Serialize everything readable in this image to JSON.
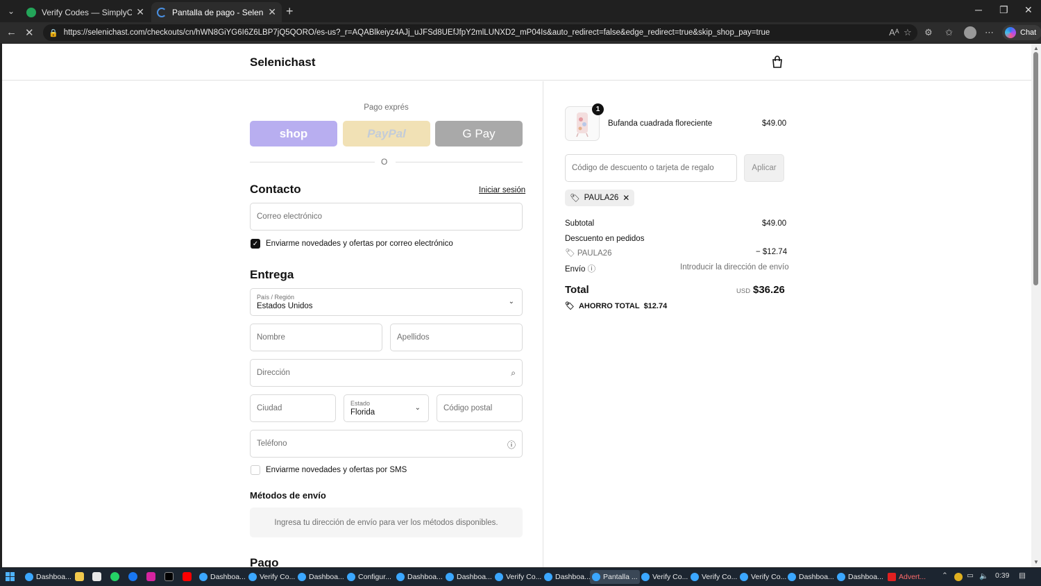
{
  "browser": {
    "tabs": [
      {
        "title": "Verify Codes — SimplyCodes",
        "favicon": "checkmark-icon",
        "color": "#23a559",
        "active": false
      },
      {
        "title": "Pantalla de pago - Selenichast",
        "favicon": "loading-icon",
        "color": "#4a90e2",
        "active": true
      }
    ],
    "url": "https://selenichast.com/checkouts/cn/hWN8GiYG6I6Z6LBP7jQ5QORO/es-us?_r=AQABlkeiyz4AJj_uJFSd8UEfJfpY2mlLUNXD2_mP04Is&auto_redirect=false&edge_redirect=true&skip_shop_pay=true",
    "chat_label": "Chat"
  },
  "store": {
    "name": "Selenichast"
  },
  "checkout": {
    "express_label": "Pago exprés",
    "express_buttons": {
      "shop": "shop",
      "paypal": "PayPal",
      "gpay": "G Pay"
    },
    "divider": "O",
    "contact_title": "Contacto",
    "login_link": "Iniciar sesión",
    "email_placeholder": "Correo electrónico",
    "email_news_label": "Enviarme novedades y ofertas por correo electrónico",
    "email_news_checked": true,
    "delivery_title": "Entrega",
    "country_label": "País / Región",
    "country_value": "Estados Unidos",
    "first_name_placeholder": "Nombre",
    "last_name_placeholder": "Apellidos",
    "address_placeholder": "Dirección",
    "city_placeholder": "Ciudad",
    "state_label": "Estado",
    "state_value": "Florida",
    "zip_placeholder": "Código postal",
    "phone_placeholder": "Teléfono",
    "sms_news_label": "Enviarme novedades y ofertas por SMS",
    "sms_news_checked": false,
    "shipping_methods_title": "Métodos de envío",
    "shipping_methods_info": "Ingresa tu dirección de envío para ver los métodos disponibles.",
    "payment_title": "Pago"
  },
  "summary": {
    "item": {
      "name": "Bufanda cuadrada floreciente",
      "price": "$49.00",
      "qty": "1"
    },
    "discount_placeholder": "Código de descuento o tarjeta de regalo",
    "apply_label": "Aplicar",
    "applied_code": "PAULA26",
    "subtotal_label": "Subtotal",
    "subtotal_value": "$49.00",
    "order_discount_label": "Descuento en pedidos",
    "discount_code": "PAULA26",
    "discount_value": "− $12.74",
    "shipping_label": "Envío",
    "shipping_value": "Introducir la dirección de envío",
    "total_label": "Total",
    "currency": "USD",
    "total_value": "$36.26",
    "savings_label": "AHORRO TOTAL",
    "savings_value": "$12.74"
  },
  "taskbar": {
    "items": [
      {
        "label": "Dashboa...",
        "active": false
      },
      {
        "label": "Dashboa...",
        "active": false
      },
      {
        "label": "Verify Co...",
        "active": false
      },
      {
        "label": "Dashboa...",
        "active": false
      },
      {
        "label": "Configur...",
        "active": false
      },
      {
        "label": "Dashboa...",
        "active": false
      },
      {
        "label": "Dashboa...",
        "active": false
      },
      {
        "label": "Verify Co...",
        "active": false
      },
      {
        "label": "Dashboa...",
        "active": false
      },
      {
        "label": "Pantalla ...",
        "active": true
      },
      {
        "label": "Verify Co...",
        "active": false
      },
      {
        "label": "Verify Co...",
        "active": false
      },
      {
        "label": "Verify Co...",
        "active": false
      },
      {
        "label": "Dashboa...",
        "active": false
      },
      {
        "label": "Dashboa...",
        "active": false
      },
      {
        "label": "Advert...",
        "active": false
      }
    ],
    "time": "0:39"
  }
}
